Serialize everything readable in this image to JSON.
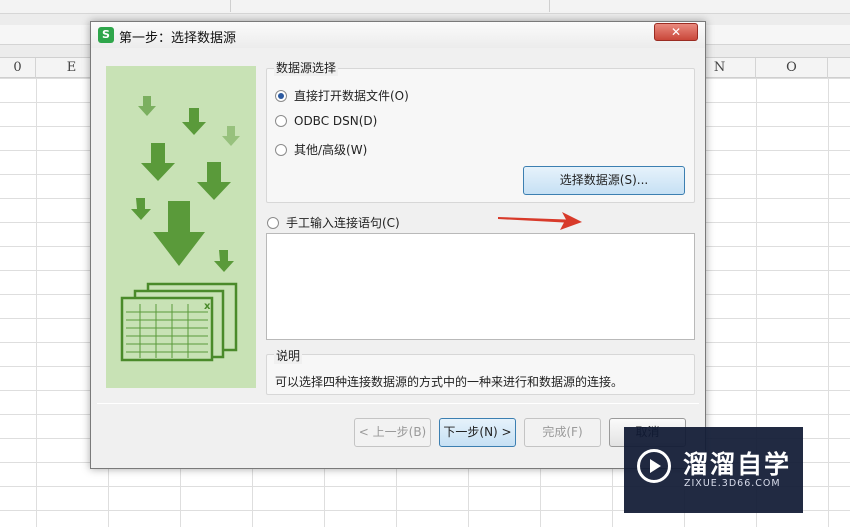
{
  "spreadsheet": {
    "column_headers": [
      {
        "label": "D",
        "visible_text": "0"
      },
      {
        "label": "E",
        "visible_text": "E"
      },
      {
        "label": "N",
        "visible_text": "N"
      },
      {
        "label": "O",
        "visible_text": "O"
      }
    ]
  },
  "dialog": {
    "title": "第一步：选择数据源",
    "close_label": "✕",
    "data_source_group": {
      "label": "数据源选择",
      "options": [
        {
          "label": "直接打开数据文件(O)",
          "checked": true
        },
        {
          "label": "ODBC DSN(D)",
          "checked": false
        },
        {
          "label": "其他/高级(W)",
          "checked": false
        }
      ],
      "select_button": "选择数据源(S)..."
    },
    "manual_option": {
      "label": "手工输入连接语句(C)",
      "checked": false
    },
    "manual_text_value": "",
    "description_group": {
      "label": "说明",
      "text": "可以选择四种连接数据源的方式中的一种来进行和数据源的连接。"
    },
    "buttons": {
      "prev": "< 上一步(B)",
      "next": "下一步(N) >",
      "finish": "完成(F)",
      "cancel": "取消"
    }
  },
  "watermark": {
    "title": "溜溜自学",
    "subtitle": "ZIXUE.3D66.COM"
  },
  "colors": {
    "illustration_bg": "#c8e2b5",
    "arrow_green": "#5a9a3a",
    "accent_red": "#d83a2a"
  }
}
